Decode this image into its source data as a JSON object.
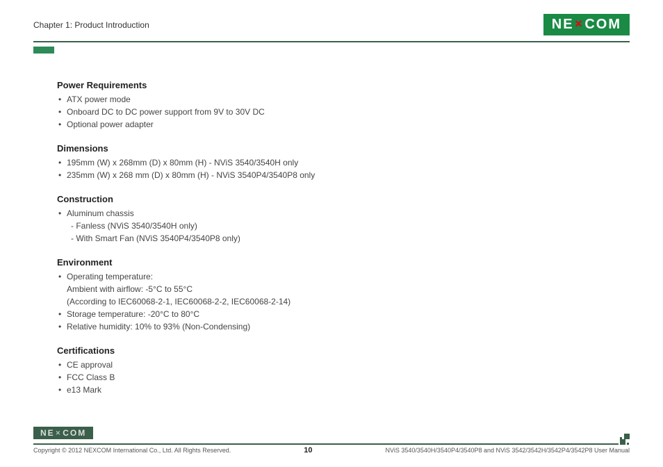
{
  "header": {
    "chapter": "Chapter 1: Product Introduction",
    "logo_text_a": "NE",
    "logo_text_b": "COM"
  },
  "sections": {
    "power": {
      "title": "Power Requirements",
      "items": [
        "ATX power mode",
        "Onboard DC to DC power support from 9V to 30V DC",
        "Optional power adapter"
      ]
    },
    "dimensions": {
      "title": "Dimensions",
      "items": [
        "195mm (W) x 268mm (D) x 80mm (H) - NViS 3540/3540H only",
        "235mm (W) x 268 mm (D) x 80mm (H) - NViS 3540P4/3540P8 only"
      ]
    },
    "construction": {
      "title": "Construction",
      "item0": "Aluminum chassis",
      "sub0": "- Fanless (NViS 3540/3540H only)",
      "sub1": "- With Smart Fan (NViS 3540P4/3540P8 only)"
    },
    "environment": {
      "title": "Environment",
      "item0": "Operating temperature:",
      "item0b": "Ambient with airflow: -5°C to 55°C",
      "item0c": "(According to IEC60068-2-1, IEC60068-2-2, IEC60068-2-14)",
      "item1": "Storage temperature: -20°C to 80°C",
      "item2": "Relative humidity: 10% to 93% (Non-Condensing)"
    },
    "certifications": {
      "title": "Certifications",
      "items": [
        "CE approval",
        "FCC Class B",
        "e13 Mark"
      ]
    }
  },
  "footer": {
    "copyright": "Copyright © 2012 NEXCOM International Co., Ltd. All Rights Reserved.",
    "page": "10",
    "manual": "NViS 3540/3540H/3540P4/3540P8 and NViS 3542/3542H/3542P4/3542P8 User Manual"
  }
}
